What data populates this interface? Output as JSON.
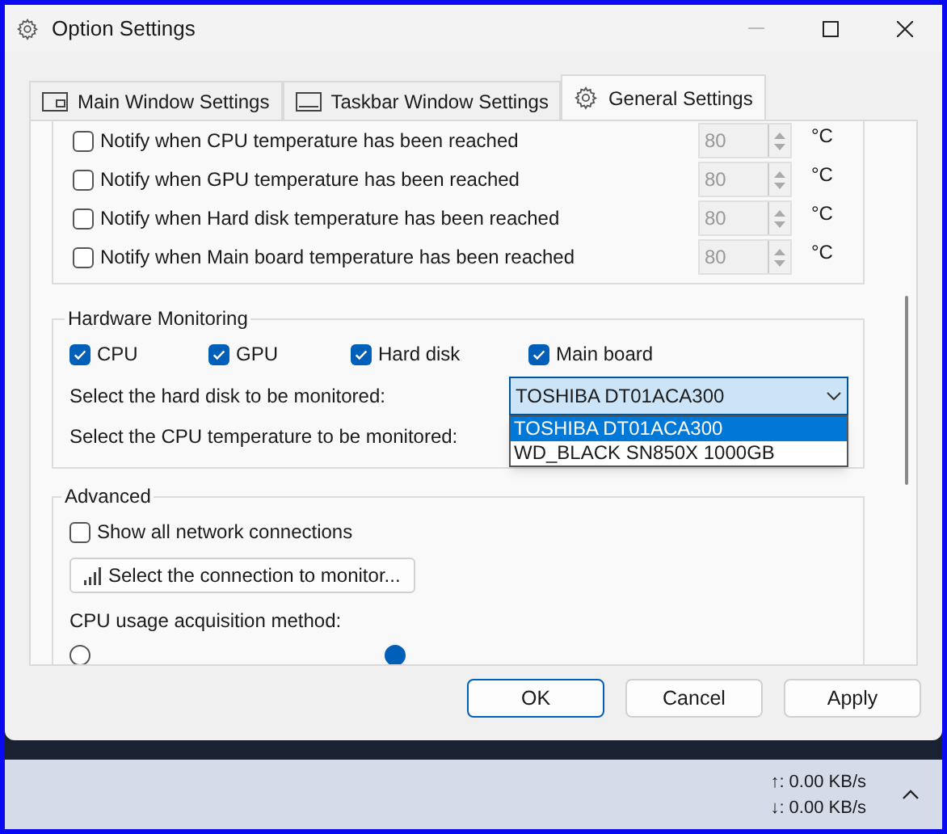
{
  "window": {
    "title": "Option Settings"
  },
  "tabs": [
    {
      "label": "Main Window Settings",
      "selected": false
    },
    {
      "label": "Taskbar Window Settings",
      "selected": false
    },
    {
      "label": "General Settings",
      "selected": true
    }
  ],
  "notifications": [
    {
      "label": "Notify when CPU temperature has been reached",
      "checked": false,
      "value": "80",
      "unit": "°C"
    },
    {
      "label": "Notify when GPU temperature has been reached",
      "checked": false,
      "value": "80",
      "unit": "°C"
    },
    {
      "label": "Notify when Hard disk temperature has been reached",
      "checked": false,
      "value": "80",
      "unit": "°C"
    },
    {
      "label": "Notify when Main board temperature has been reached",
      "checked": false,
      "value": "80",
      "unit": "°C"
    }
  ],
  "hardware_monitoring": {
    "title": "Hardware Monitoring",
    "items": [
      {
        "label": "CPU",
        "checked": true
      },
      {
        "label": "GPU",
        "checked": true
      },
      {
        "label": "Hard disk",
        "checked": true
      },
      {
        "label": "Main board",
        "checked": true
      }
    ],
    "hard_disk": {
      "label": "Select the hard disk to be monitored:",
      "value": "TOSHIBA DT01ACA300",
      "expanded": true,
      "options": [
        {
          "label": "TOSHIBA DT01ACA300",
          "selected": true
        },
        {
          "label": "WD_BLACK SN850X 1000GB",
          "selected": false
        }
      ]
    },
    "cpu_temperature": {
      "label": "Select the CPU temperature to be monitored:"
    }
  },
  "advanced": {
    "title": "Advanced",
    "show_all_connections": {
      "label": "Show all network connections",
      "checked": false
    },
    "connection_button": "Select the connection to monitor...",
    "cpu_method_label": "CPU usage acquisition method:",
    "cpu_methods": [
      {
        "selected": false
      },
      {
        "selected": true
      }
    ]
  },
  "buttons": [
    {
      "label": "OK",
      "default": true
    },
    {
      "label": "Cancel",
      "default": false
    },
    {
      "label": "Apply",
      "default": false
    }
  ],
  "taskbar": {
    "upload": "↑: 0.00 KB/s",
    "download": "↓: 0.00 KB/s"
  }
}
